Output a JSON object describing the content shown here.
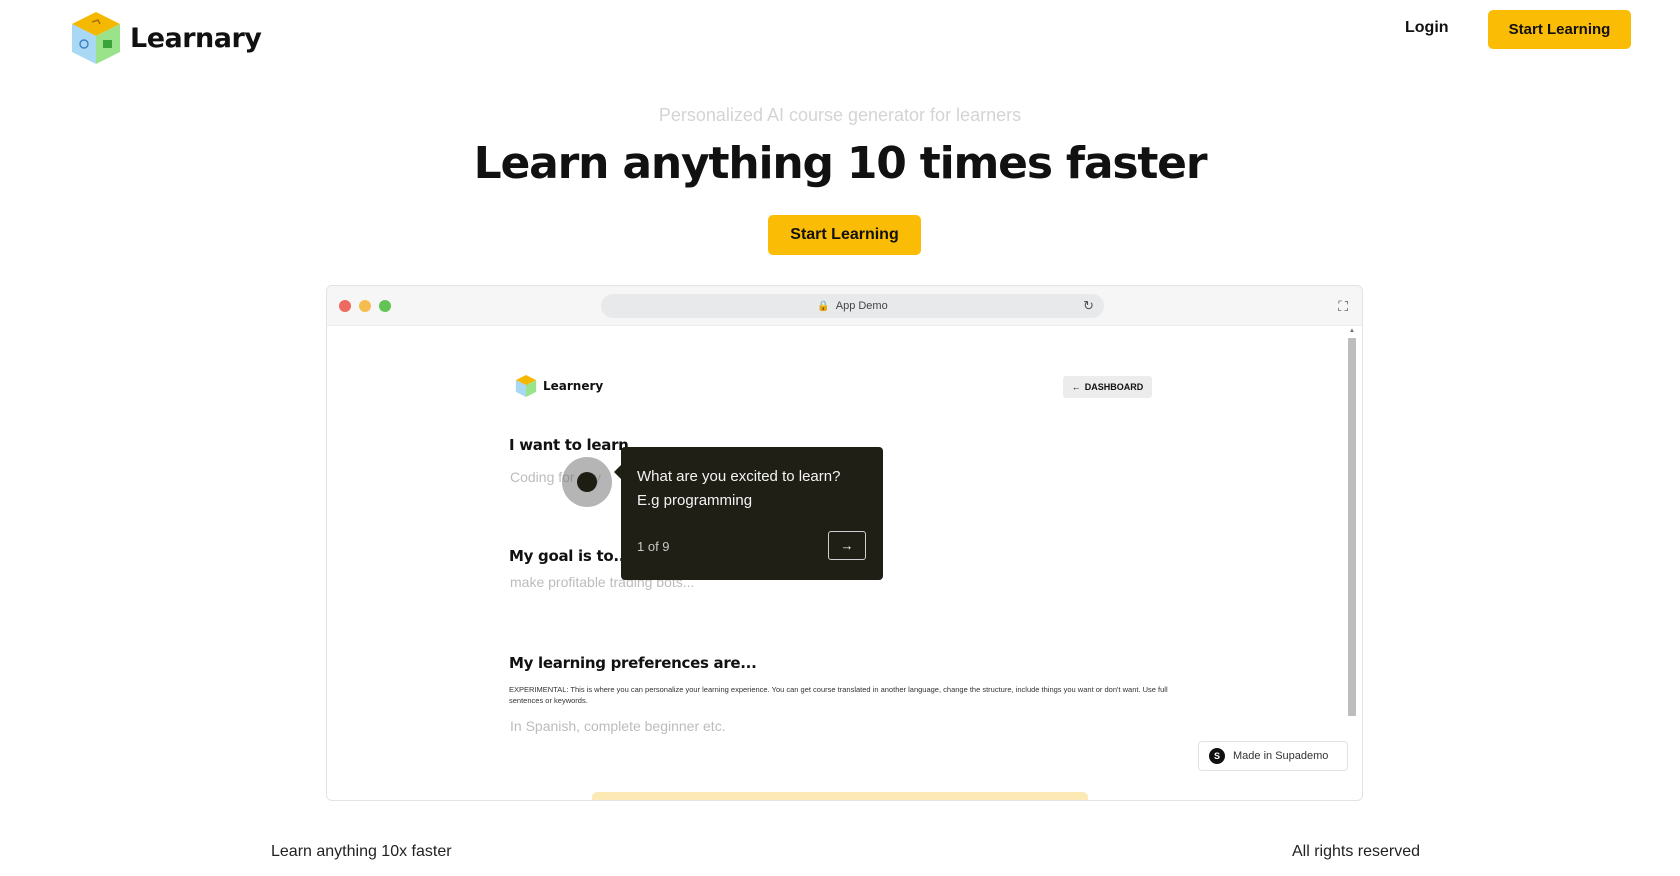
{
  "header": {
    "brand": "Learnary",
    "login_label": "Login",
    "cta_label": "Start Learning"
  },
  "hero": {
    "subtitle": "Personalized AI course generator for learners",
    "title": "Learn anything 10 times faster",
    "cta_label": "Start Learning"
  },
  "demo": {
    "url_label": "App Demo",
    "inner_brand": "Learnery",
    "dashboard_label": "DASHBOARD",
    "question1": "I want to learn...",
    "question1_placeholder": "Coding for any",
    "question2": "My goal is to...",
    "question2_placeholder": "make profitable trading bots...",
    "question3": "My learning preferences are...",
    "experimental_note": "EXPERIMENTAL: This is where you can personalize your learning experience. You can get course translated in another language, change the structure, include things you want or don't want. Use full sentences or keywords.",
    "question3_placeholder": "In Spanish, complete beginner etc.",
    "tooltip": {
      "text": "What are you excited to learn? E.g programming",
      "step": "1 of 9"
    },
    "made_in_label": "Made in Supademo",
    "made_in_logo": "S"
  },
  "footer": {
    "left": "Learn anything 10x faster",
    "right": "All rights reserved"
  },
  "colors": {
    "accent": "#fbbc05",
    "tooltip_bg": "#1f1f16"
  },
  "icons": {
    "lock": "lock-icon",
    "reload": "reload-icon",
    "expand": "expand-icon",
    "arrow_left": "arrow-left-icon",
    "arrow_right": "arrow-right-icon"
  }
}
